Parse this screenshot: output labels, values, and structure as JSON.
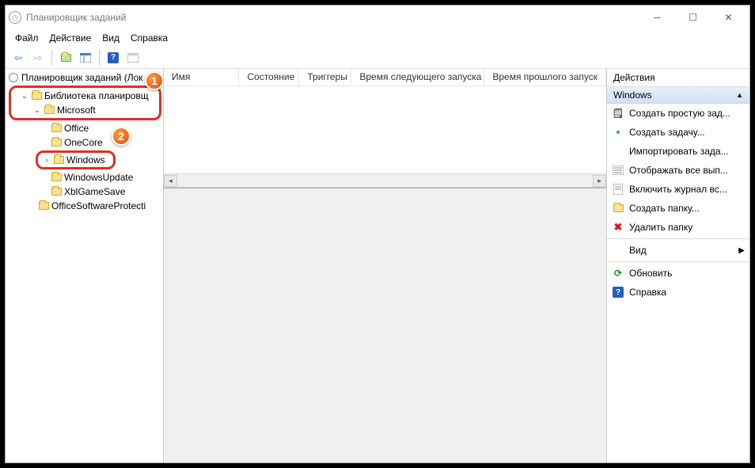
{
  "window": {
    "title": "Планировщик заданий"
  },
  "menu": {
    "file": "Файл",
    "action": "Действие",
    "view": "Вид",
    "help": "Справка"
  },
  "tree": {
    "root": "Планировщик заданий (Лок",
    "library": "Библиотека планировщ",
    "microsoft": "Microsoft",
    "office": "Office",
    "onecore": "OneCore",
    "windows": "Windows",
    "windowsupdate": "WindowsUpdate",
    "xblgamesave": "XblGameSave",
    "officesoftware": "OfficeSoftwareProtecti"
  },
  "badges": {
    "one": "1",
    "two": "2"
  },
  "columns": {
    "name": "Имя",
    "state": "Состояние",
    "triggers": "Триггеры",
    "nextrun": "Время следующего запуска",
    "lastrun": "Время прошлого запуск"
  },
  "actions": {
    "title": "Действия",
    "context": "Windows",
    "create_basic": "Создать простую зад...",
    "create_task": "Создать задачу...",
    "import": "Импортировать зада...",
    "show_all": "Отображать все вып...",
    "enable_log": "Включить журнал вс...",
    "new_folder": "Создать папку...",
    "delete_folder": "Удалить папку",
    "view": "Вид",
    "refresh": "Обновить",
    "help": "Справка"
  }
}
